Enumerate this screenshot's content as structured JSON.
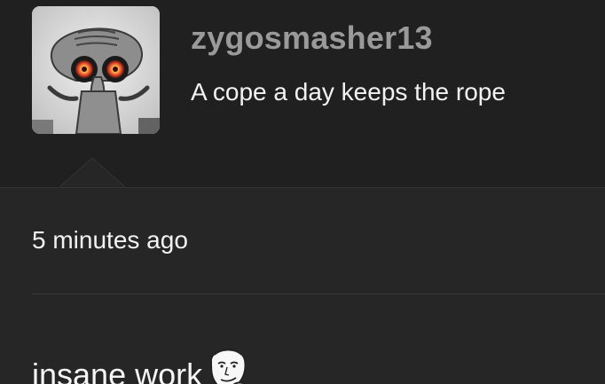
{
  "profile": {
    "username": "zygosmasher13",
    "bio": "A cope a day keeps the rope",
    "avatar_icon": "squidward-avatar"
  },
  "post": {
    "timestamp": "5 minutes ago",
    "comment_text": "insane work",
    "comment_emoji": "wojak-smirk-face"
  },
  "colors": {
    "background": "#262626",
    "header_background": "#202020",
    "username": "#9a9a9a",
    "text": "#f2f2f2",
    "divider": "#3a3a3a"
  }
}
